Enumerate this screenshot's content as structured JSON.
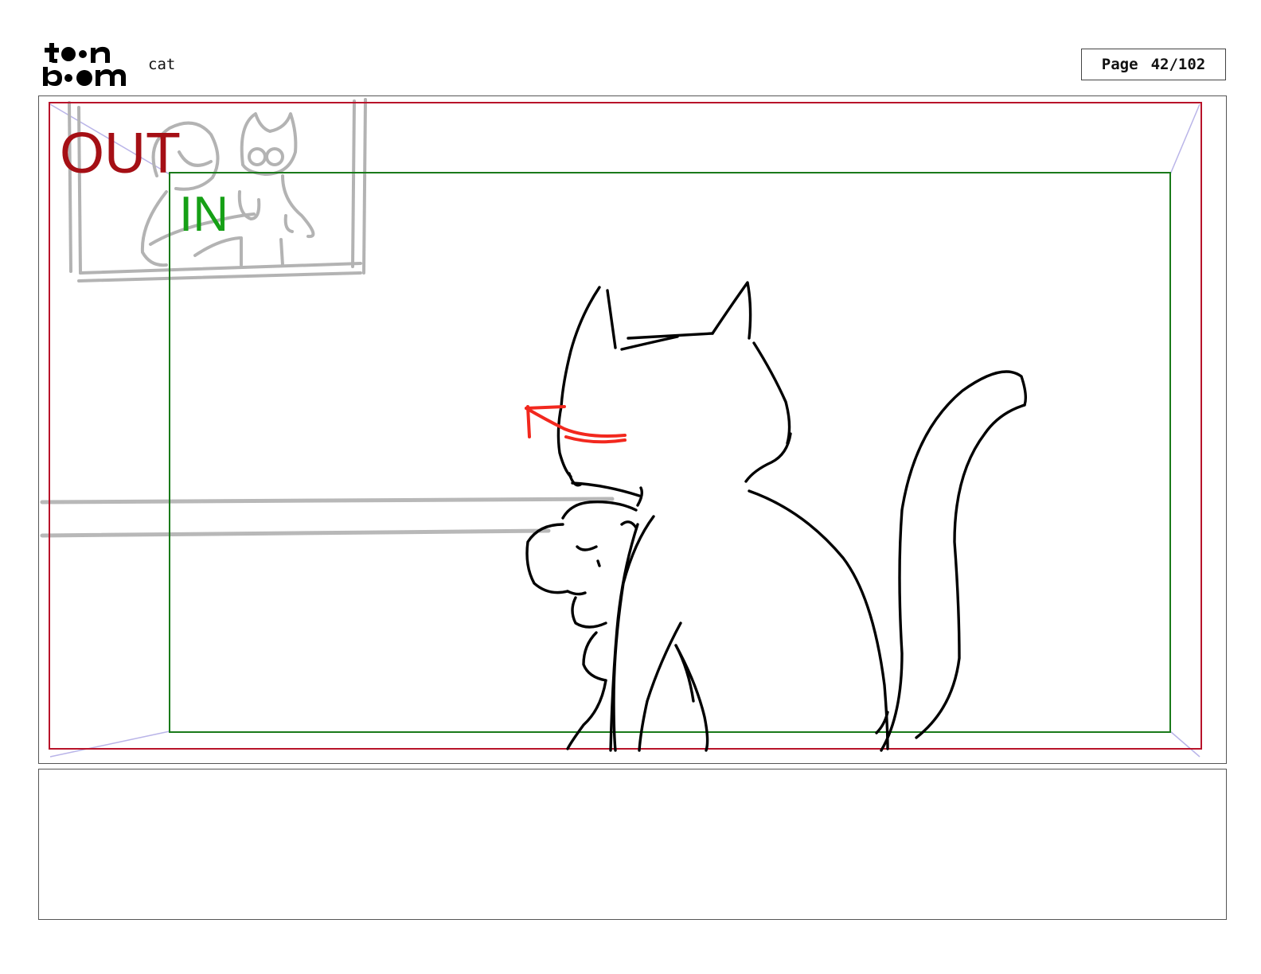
{
  "header": {
    "logo_alt": "toon boom",
    "project_name": "cat",
    "page_label": "Page",
    "page_number": "42/102"
  },
  "panel": {
    "out_label": "OUT",
    "in_label": "IN",
    "colors": {
      "out_frame": "#b8132a",
      "in_frame": "#1a7a1a",
      "guide": "#b9b4e8",
      "sketch_grey": "#b0b0b0",
      "ink": "#000000",
      "arrow": "#f2281e"
    }
  },
  "caption": {
    "text": ""
  }
}
